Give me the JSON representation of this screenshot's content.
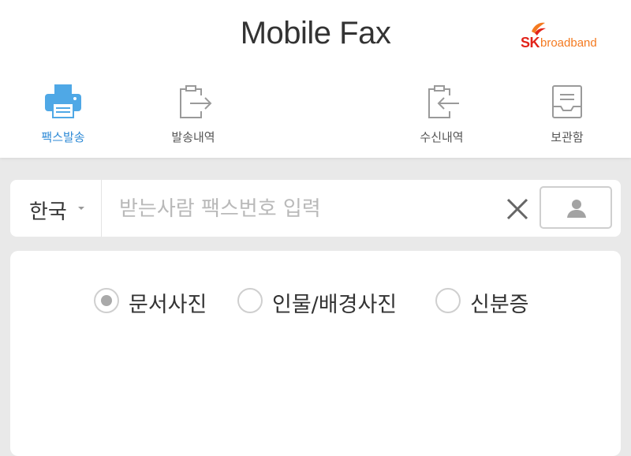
{
  "header": {
    "title": "Mobile Fax",
    "brand": {
      "sk": "SK",
      "name": "broadband"
    }
  },
  "nav": {
    "items": [
      {
        "label": "팩스발송",
        "icon": "printer-icon",
        "active": true
      },
      {
        "label": "발송내역",
        "icon": "send-history-icon",
        "active": false
      },
      {
        "label": "수신내역",
        "icon": "receive-history-icon",
        "active": false
      },
      {
        "label": "보관함",
        "icon": "storage-box-icon",
        "active": false
      }
    ]
  },
  "fax_bar": {
    "country": "한국",
    "placeholder": "받는사람 팩스번호 입력",
    "value": ""
  },
  "document_types": [
    {
      "label": "문서사진",
      "checked": true
    },
    {
      "label": "인물/배경사진",
      "checked": false
    },
    {
      "label": "신분증",
      "checked": false
    }
  ],
  "colors": {
    "accent": "#2e8ad6",
    "printer": "#4fa8e6",
    "brand_red": "#e2231a",
    "brand_orange": "#f47a20",
    "icon_gray": "#9a9a9a"
  }
}
